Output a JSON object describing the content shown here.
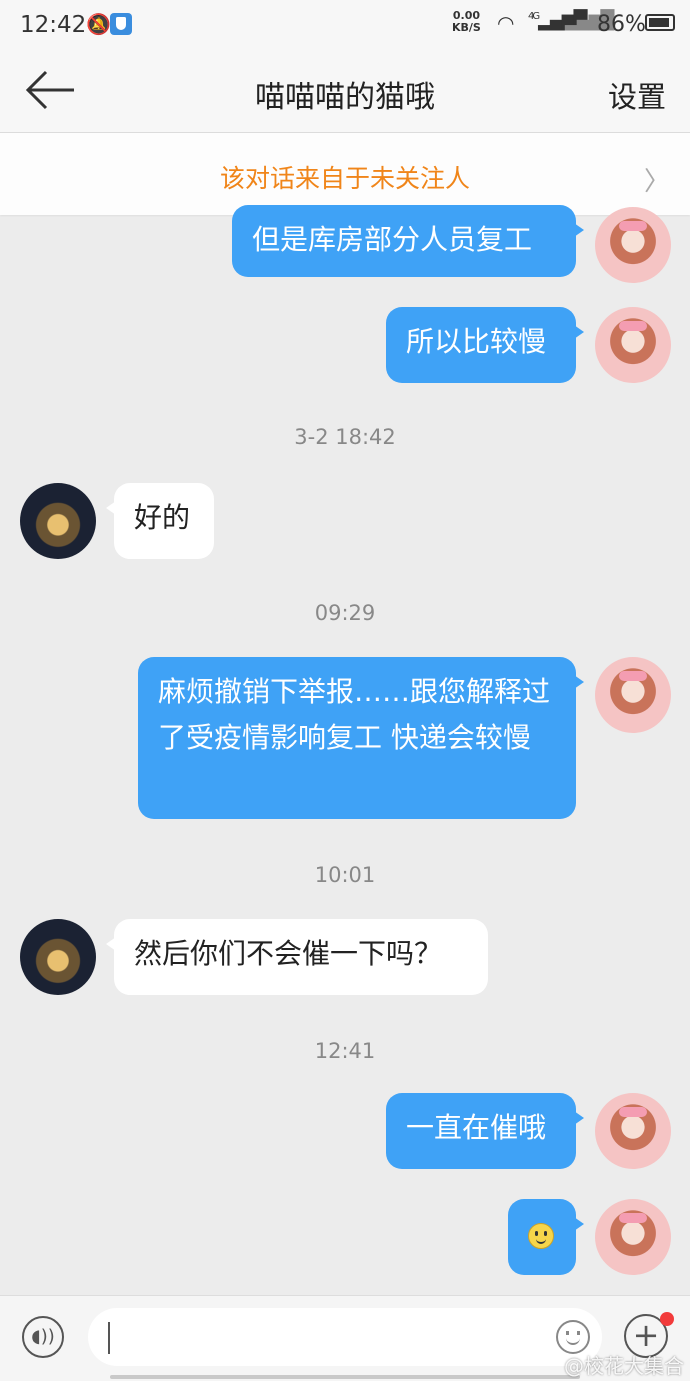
{
  "status_bar": {
    "time": "12:42",
    "network_speed_value": "0.00",
    "network_speed_unit": "KB/S",
    "network_type": "4G",
    "battery": "86%"
  },
  "header": {
    "title": "喵喵喵的猫哦",
    "settings_label": "设置"
  },
  "banner": {
    "text": "该对话来自于未关注人"
  },
  "messages": [
    {
      "sender": "me",
      "text": "但是库房部分人员复工"
    },
    {
      "sender": "me",
      "text": "所以比较慢"
    },
    {
      "type": "timestamp",
      "text": "3-2 18:42"
    },
    {
      "sender": "other",
      "text": "好的"
    },
    {
      "type": "timestamp",
      "text": "09:29"
    },
    {
      "sender": "me",
      "text": "麻烦撤销下举报……跟您解释过了受疫情影响复工 快递会较慢"
    },
    {
      "type": "timestamp",
      "text": "10:01"
    },
    {
      "sender": "other",
      "text": "然后你们不会催一下吗？"
    },
    {
      "type": "timestamp",
      "text": "12:41"
    },
    {
      "sender": "me",
      "text": "一直在催哦"
    },
    {
      "sender": "me",
      "emoji": "smiley-emoji"
    }
  ],
  "input_bar": {
    "placeholder": ""
  },
  "watermark": "@校花大集合",
  "colors": {
    "my_bubble": "#3fa2f6",
    "other_bubble": "#ffffff",
    "banner_text": "#f08519",
    "background": "#ececec"
  }
}
